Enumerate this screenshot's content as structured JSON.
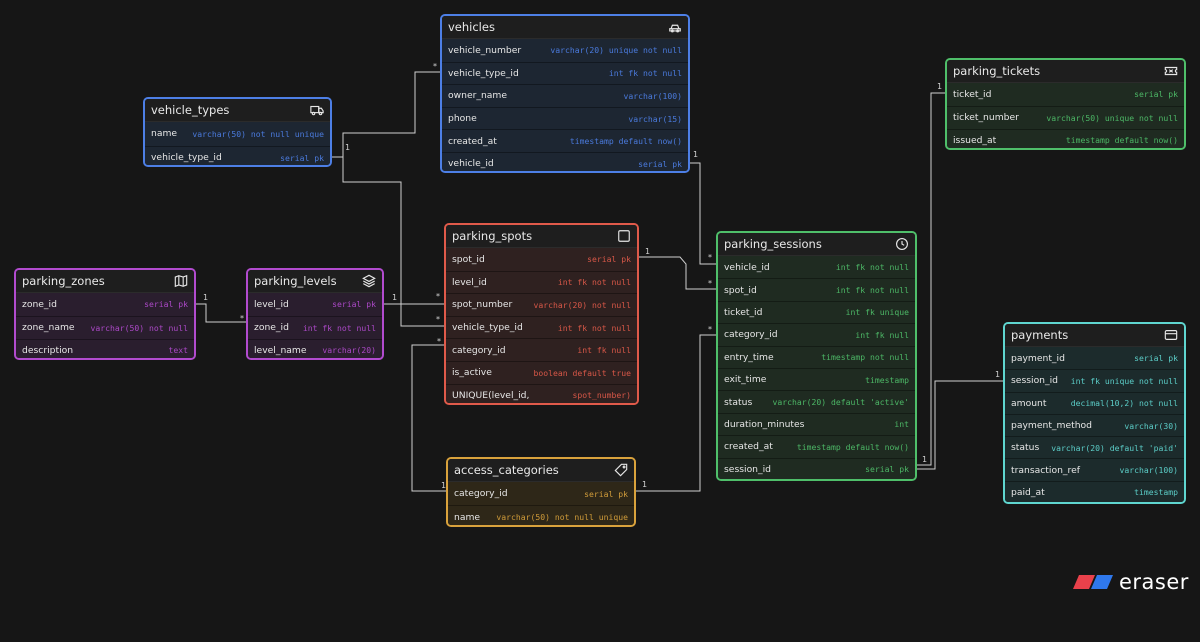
{
  "colors": {
    "background": "#161616",
    "connector": "#d0d0d0",
    "blue": "#4d7fe6",
    "purple": "#b24bcf",
    "red": "#e05a4a",
    "green": "#4fbf6a",
    "orange": "#d9a23c",
    "teal": "#5fd6d0"
  },
  "tables": [
    {
      "name": "vehicles",
      "color": "#4d7fe6",
      "bg": "#1d2632",
      "icon": "car-icon",
      "fields": [
        {
          "name": "vehicle_number",
          "type": "varchar(20) unique not null"
        },
        {
          "name": "vehicle_type_id",
          "type": "int fk not null"
        },
        {
          "name": "owner_name",
          "type": "varchar(100)"
        },
        {
          "name": "phone",
          "type": "varchar(15)"
        },
        {
          "name": "created_at",
          "type": "timestamp default now()"
        },
        {
          "name": "vehicle_id",
          "type": "serial pk"
        }
      ]
    },
    {
      "name": "vehicle_types",
      "color": "#4d7fe6",
      "bg": "#1d2632",
      "icon": "truck-icon",
      "fields": [
        {
          "name": "name",
          "type": "varchar(50) not null unique"
        },
        {
          "name": "vehicle_type_id",
          "type": "serial pk"
        }
      ]
    },
    {
      "name": "parking_tickets",
      "color": "#4fbf6a",
      "bg": "#1f2b21",
      "icon": "ticket-icon",
      "fields": [
        {
          "name": "ticket_id",
          "type": "serial pk"
        },
        {
          "name": "ticket_number",
          "type": "varchar(50) unique not null"
        },
        {
          "name": "issued_at",
          "type": "timestamp default now()"
        }
      ]
    },
    {
      "name": "parking_spots",
      "color": "#e05a4a",
      "bg": "#2f2120",
      "icon": "square-icon",
      "fields": [
        {
          "name": "spot_id",
          "type": "serial pk"
        },
        {
          "name": "level_id",
          "type": "int fk not null"
        },
        {
          "name": "spot_number",
          "type": "varchar(20) not null"
        },
        {
          "name": "vehicle_type_id",
          "type": "int fk not null"
        },
        {
          "name": "category_id",
          "type": "int fk null"
        },
        {
          "name": "is_active",
          "type": "boolean default true"
        },
        {
          "name": "UNIQUE(level_id,",
          "type": "spot_number)"
        }
      ]
    },
    {
      "name": "parking_sessions",
      "color": "#4fbf6a",
      "bg": "#1f2b21",
      "icon": "clock-icon",
      "fields": [
        {
          "name": "vehicle_id",
          "type": "int fk not null"
        },
        {
          "name": "spot_id",
          "type": "int fk not null"
        },
        {
          "name": "ticket_id",
          "type": "int fk unique"
        },
        {
          "name": "category_id",
          "type": "int fk null"
        },
        {
          "name": "entry_time",
          "type": "timestamp not null"
        },
        {
          "name": "exit_time",
          "type": "timestamp"
        },
        {
          "name": "status",
          "type": "varchar(20) default 'active'"
        },
        {
          "name": "duration_minutes",
          "type": "int"
        },
        {
          "name": "created_at",
          "type": "timestamp default now()"
        },
        {
          "name": "session_id",
          "type": "serial pk"
        }
      ]
    },
    {
      "name": "parking_zones",
      "color": "#b24bcf",
      "bg": "#2a1e2e",
      "icon": "map-icon",
      "fields": [
        {
          "name": "zone_id",
          "type": "serial pk"
        },
        {
          "name": "zone_name",
          "type": "varchar(50) not null"
        },
        {
          "name": "description",
          "type": "text"
        }
      ]
    },
    {
      "name": "parking_levels",
      "color": "#b24bcf",
      "bg": "#2a1e2e",
      "icon": "layers-icon",
      "fields": [
        {
          "name": "level_id",
          "type": "serial pk"
        },
        {
          "name": "zone_id",
          "type": "int fk not null"
        },
        {
          "name": "level_name",
          "type": "varchar(20)"
        }
      ]
    },
    {
      "name": "payments",
      "color": "#5fd6d0",
      "bg": "#1c2b2c",
      "icon": "credit-card-icon",
      "fields": [
        {
          "name": "payment_id",
          "type": "serial pk"
        },
        {
          "name": "session_id",
          "type": "int fk unique not null"
        },
        {
          "name": "amount",
          "type": "decimal(10,2) not null"
        },
        {
          "name": "payment_method",
          "type": "varchar(30)"
        },
        {
          "name": "status",
          "type": "varchar(20) default 'paid'"
        },
        {
          "name": "transaction_ref",
          "type": "varchar(100)"
        },
        {
          "name": "paid_at",
          "type": "timestamp"
        }
      ]
    },
    {
      "name": "access_categories",
      "color": "#d9a23c",
      "bg": "#2e2718",
      "icon": "tag-icon",
      "fields": [
        {
          "name": "category_id",
          "type": "serial pk"
        },
        {
          "name": "name",
          "type": "varchar(50) not null unique"
        }
      ]
    }
  ],
  "relations": [
    {
      "from": "vehicle_types.vehicle_type_id",
      "to": "vehicles.vehicle_type_id",
      "from_card": "1",
      "to_card": "*"
    },
    {
      "from": "vehicle_types.vehicle_type_id",
      "to": "parking_spots.vehicle_type_id",
      "from_card": "1",
      "to_card": "*"
    },
    {
      "from": "vehicles.vehicle_id",
      "to": "parking_sessions.vehicle_id",
      "from_card": "1",
      "to_card": "*"
    },
    {
      "from": "parking_spots.spot_id",
      "to": "parking_sessions.spot_id",
      "from_card": "1",
      "to_card": "*"
    },
    {
      "from": "parking_zones.zone_id",
      "to": "parking_levels.zone_id",
      "from_card": "1",
      "to_card": "*"
    },
    {
      "from": "parking_levels.level_id",
      "to": "parking_spots.level_id",
      "from_card": "1",
      "to_card": "*"
    },
    {
      "from": "access_categories.category_id",
      "to": "parking_spots.category_id",
      "from_card": "1",
      "to_card": "*"
    },
    {
      "from": "access_categories.category_id",
      "to": "parking_sessions.category_id",
      "from_card": "1",
      "to_card": "*"
    },
    {
      "from": "parking_tickets.ticket_id",
      "to": "parking_sessions.ticket_id",
      "from_card": "1",
      "to_card": "1"
    },
    {
      "from": "parking_sessions.session_id",
      "to": "payments.session_id",
      "from_card": "1",
      "to_card": "1"
    }
  ],
  "logo": {
    "text": "eraser",
    "icon": "eraser-logo-icon"
  }
}
